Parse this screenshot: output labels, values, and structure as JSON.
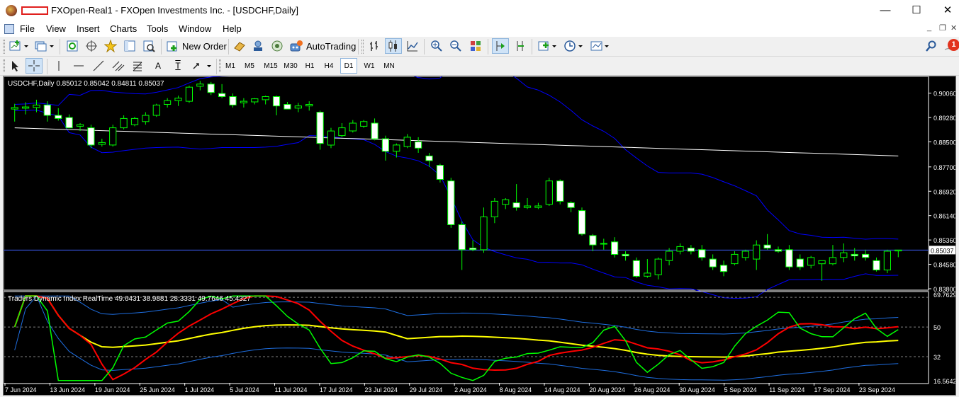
{
  "window": {
    "title": "FXOpen-Real1 - FXOpen Investments Inc. - [USDCHF,Daily]",
    "minimize_glyph": "—",
    "maximize_glyph": "☐",
    "close_glyph": "✕"
  },
  "menu": {
    "items": [
      "File",
      "View",
      "Insert",
      "Charts",
      "Tools",
      "Window",
      "Help"
    ],
    "mdi_minimize": "_",
    "mdi_restore": "❐",
    "mdi_close": "✕"
  },
  "toolbar": {
    "new_order_label": "New Order",
    "autotrading_label": "AutoTrading",
    "alert_count": "1",
    "icons": [
      "new-chart-icon",
      "profiles-icon",
      "market-watch-icon",
      "navigator-icon",
      "favorites-icon",
      "data-window-icon",
      "strategy-tester-icon",
      "new-order-icon",
      "metaeditor-icon",
      "signals-icon",
      "market-icon",
      "autotrading-icon",
      "bar-chart-icon",
      "candlestick-icon",
      "line-chart-icon",
      "zoom-in-icon",
      "zoom-out-icon",
      "tile-windows-icon",
      "chart-shift-icon",
      "autoscroll-icon",
      "indicators-icon",
      "periods-icon",
      "templates-icon",
      "search-icon",
      "alerts-icon"
    ]
  },
  "drawing_toolbar": {
    "text_tool": "A",
    "label_tool": "T"
  },
  "timeframes": {
    "items": [
      "M1",
      "M5",
      "M15",
      "M30",
      "H1",
      "H4",
      "D1",
      "W1",
      "MN"
    ],
    "selected": "D1"
  },
  "chart": {
    "header": "USDCHF,Daily  0.85012 0.85042 0.84811 0.85037",
    "current_price": "0.85037",
    "indicator_header": "Traders Dynamic Index RealTime 49.6431 38.9881 28.3331 49.7646 45.4327",
    "colors": {
      "background": "#000000",
      "bull_candle": "#00ff00",
      "bear_candle": "#ffffff",
      "bollinger": "#0000ff",
      "ma200": "#ffffff",
      "current_price_line": "#4060ff",
      "tdi_bands": "#1e6ee0",
      "tdi_price_line": "#00ff00",
      "tdi_signal_line": "#ff0000",
      "tdi_base_line": "#ffff00"
    }
  },
  "chart_data": {
    "type": "candlestick",
    "symbol": "USDCHF",
    "timeframe": "Daily",
    "ylim": [
      0.838,
      0.9055
    ],
    "price_ticks": [
      "0.90060",
      "0.89280",
      "0.88500",
      "0.87700",
      "0.86920",
      "0.86140",
      "0.85360",
      "0.84580",
      "0.83800"
    ],
    "current_price": 0.85037,
    "x_labels": [
      "7 Jun 2024",
      "13 Jun 2024",
      "19 Jun 2024",
      "25 Jun 2024",
      "1 Jul 2024",
      "5 Jul 2024",
      "11 Jul 2024",
      "17 Jul 2024",
      "23 Jul 2024",
      "29 Jul 2024",
      "2 Aug 2024",
      "8 Aug 2024",
      "14 Aug 2024",
      "20 Aug 2024",
      "26 Aug 2024",
      "30 Aug 2024",
      "5 Sep 2024",
      "11 Sep 2024",
      "17 Sep 2024",
      "23 Sep 2024"
    ],
    "candles": [
      {
        "o": 0.8955,
        "h": 0.8972,
        "l": 0.8915,
        "c": 0.896
      },
      {
        "o": 0.8958,
        "h": 0.8977,
        "l": 0.8938,
        "c": 0.8962
      },
      {
        "o": 0.896,
        "h": 0.8985,
        "l": 0.8945,
        "c": 0.8968
      },
      {
        "o": 0.8968,
        "h": 0.898,
        "l": 0.8915,
        "c": 0.8935
      },
      {
        "o": 0.8935,
        "h": 0.8958,
        "l": 0.8918,
        "c": 0.8925
      },
      {
        "o": 0.8928,
        "h": 0.8938,
        "l": 0.8905,
        "c": 0.8895
      },
      {
        "o": 0.89,
        "h": 0.891,
        "l": 0.8885,
        "c": 0.8905
      },
      {
        "o": 0.8895,
        "h": 0.8905,
        "l": 0.883,
        "c": 0.884
      },
      {
        "o": 0.8842,
        "h": 0.886,
        "l": 0.8835,
        "c": 0.8848
      },
      {
        "o": 0.884,
        "h": 0.8905,
        "l": 0.8835,
        "c": 0.8895
      },
      {
        "o": 0.8895,
        "h": 0.8935,
        "l": 0.889,
        "c": 0.8925
      },
      {
        "o": 0.8905,
        "h": 0.893,
        "l": 0.89,
        "c": 0.8925
      },
      {
        "o": 0.8915,
        "h": 0.8945,
        "l": 0.8905,
        "c": 0.8935
      },
      {
        "o": 0.8935,
        "h": 0.8972,
        "l": 0.893,
        "c": 0.8968
      },
      {
        "o": 0.897,
        "h": 0.899,
        "l": 0.896,
        "c": 0.8982
      },
      {
        "o": 0.8982,
        "h": 0.8998,
        "l": 0.8965,
        "c": 0.899
      },
      {
        "o": 0.898,
        "h": 0.903,
        "l": 0.8975,
        "c": 0.9025
      },
      {
        "o": 0.9028,
        "h": 0.9045,
        "l": 0.9015,
        "c": 0.9035
      },
      {
        "o": 0.9035,
        "h": 0.9042,
        "l": 0.9,
        "c": 0.9008
      },
      {
        "o": 0.9005,
        "h": 0.9035,
        "l": 0.899,
        "c": 0.8995
      },
      {
        "o": 0.8995,
        "h": 0.9005,
        "l": 0.896,
        "c": 0.8968
      },
      {
        "o": 0.8975,
        "h": 0.899,
        "l": 0.896,
        "c": 0.898
      },
      {
        "o": 0.8978,
        "h": 0.899,
        "l": 0.897,
        "c": 0.8988
      },
      {
        "o": 0.8985,
        "h": 0.8998,
        "l": 0.897,
        "c": 0.8995
      },
      {
        "o": 0.8995,
        "h": 0.8998,
        "l": 0.8935,
        "c": 0.8965
      },
      {
        "o": 0.897,
        "h": 0.8978,
        "l": 0.8955,
        "c": 0.8955
      },
      {
        "o": 0.8958,
        "h": 0.8975,
        "l": 0.8945,
        "c": 0.8965
      },
      {
        "o": 0.8965,
        "h": 0.898,
        "l": 0.895,
        "c": 0.897
      },
      {
        "o": 0.8945,
        "h": 0.895,
        "l": 0.8825,
        "c": 0.8845
      },
      {
        "o": 0.884,
        "h": 0.8895,
        "l": 0.883,
        "c": 0.8885
      },
      {
        "o": 0.887,
        "h": 0.891,
        "l": 0.8865,
        "c": 0.8895
      },
      {
        "o": 0.8885,
        "h": 0.892,
        "l": 0.888,
        "c": 0.891
      },
      {
        "o": 0.89,
        "h": 0.892,
        "l": 0.8895,
        "c": 0.8915
      },
      {
        "o": 0.891,
        "h": 0.8925,
        "l": 0.8855,
        "c": 0.886
      },
      {
        "o": 0.886,
        "h": 0.887,
        "l": 0.879,
        "c": 0.882
      },
      {
        "o": 0.882,
        "h": 0.8845,
        "l": 0.88,
        "c": 0.884
      },
      {
        "o": 0.8835,
        "h": 0.8875,
        "l": 0.883,
        "c": 0.8865
      },
      {
        "o": 0.885,
        "h": 0.8865,
        "l": 0.8815,
        "c": 0.883
      },
      {
        "o": 0.8805,
        "h": 0.8815,
        "l": 0.877,
        "c": 0.879
      },
      {
        "o": 0.8775,
        "h": 0.878,
        "l": 0.872,
        "c": 0.873
      },
      {
        "o": 0.8725,
        "h": 0.8735,
        "l": 0.8575,
        "c": 0.8585
      },
      {
        "o": 0.8585,
        "h": 0.8595,
        "l": 0.844,
        "c": 0.8505
      },
      {
        "o": 0.851,
        "h": 0.8535,
        "l": 0.85,
        "c": 0.8505
      },
      {
        "o": 0.8505,
        "h": 0.864,
        "l": 0.8495,
        "c": 0.861
      },
      {
        "o": 0.861,
        "h": 0.867,
        "l": 0.859,
        "c": 0.866
      },
      {
        "o": 0.865,
        "h": 0.867,
        "l": 0.8635,
        "c": 0.8665
      },
      {
        "o": 0.8655,
        "h": 0.8715,
        "l": 0.863,
        "c": 0.864
      },
      {
        "o": 0.864,
        "h": 0.867,
        "l": 0.8635,
        "c": 0.8645
      },
      {
        "o": 0.864,
        "h": 0.8655,
        "l": 0.8635,
        "c": 0.8645
      },
      {
        "o": 0.865,
        "h": 0.8735,
        "l": 0.8645,
        "c": 0.8725
      },
      {
        "o": 0.8725,
        "h": 0.873,
        "l": 0.865,
        "c": 0.866
      },
      {
        "o": 0.8655,
        "h": 0.866,
        "l": 0.8625,
        "c": 0.864
      },
      {
        "o": 0.863,
        "h": 0.864,
        "l": 0.855,
        "c": 0.8555
      },
      {
        "o": 0.855,
        "h": 0.8555,
        "l": 0.85,
        "c": 0.852
      },
      {
        "o": 0.8525,
        "h": 0.854,
        "l": 0.8505,
        "c": 0.8525
      },
      {
        "o": 0.853,
        "h": 0.8545,
        "l": 0.848,
        "c": 0.849
      },
      {
        "o": 0.849,
        "h": 0.85,
        "l": 0.847,
        "c": 0.8485
      },
      {
        "o": 0.847,
        "h": 0.848,
        "l": 0.8415,
        "c": 0.842
      },
      {
        "o": 0.842,
        "h": 0.8475,
        "l": 0.8415,
        "c": 0.843
      },
      {
        "o": 0.8425,
        "h": 0.848,
        "l": 0.841,
        "c": 0.8475
      },
      {
        "o": 0.847,
        "h": 0.851,
        "l": 0.8455,
        "c": 0.85
      },
      {
        "o": 0.85,
        "h": 0.8525,
        "l": 0.849,
        "c": 0.8515
      },
      {
        "o": 0.851,
        "h": 0.852,
        "l": 0.849,
        "c": 0.85
      },
      {
        "o": 0.8505,
        "h": 0.852,
        "l": 0.847,
        "c": 0.848
      },
      {
        "o": 0.8475,
        "h": 0.849,
        "l": 0.844,
        "c": 0.845
      },
      {
        "o": 0.8455,
        "h": 0.847,
        "l": 0.842,
        "c": 0.8435
      },
      {
        "o": 0.846,
        "h": 0.85,
        "l": 0.8455,
        "c": 0.849
      },
      {
        "o": 0.848,
        "h": 0.8505,
        "l": 0.847,
        "c": 0.85
      },
      {
        "o": 0.8475,
        "h": 0.8535,
        "l": 0.844,
        "c": 0.852
      },
      {
        "o": 0.852,
        "h": 0.8555,
        "l": 0.8505,
        "c": 0.851
      },
      {
        "o": 0.8505,
        "h": 0.8515,
        "l": 0.8495,
        "c": 0.85
      },
      {
        "o": 0.8505,
        "h": 0.852,
        "l": 0.844,
        "c": 0.845
      },
      {
        "o": 0.8475,
        "h": 0.849,
        "l": 0.844,
        "c": 0.845
      },
      {
        "o": 0.8455,
        "h": 0.8485,
        "l": 0.8445,
        "c": 0.848
      },
      {
        "o": 0.846,
        "h": 0.847,
        "l": 0.8405,
        "c": 0.847
      },
      {
        "o": 0.846,
        "h": 0.852,
        "l": 0.8455,
        "c": 0.848
      },
      {
        "o": 0.848,
        "h": 0.8525,
        "l": 0.8465,
        "c": 0.8495
      },
      {
        "o": 0.849,
        "h": 0.851,
        "l": 0.847,
        "c": 0.8485
      },
      {
        "o": 0.849,
        "h": 0.8505,
        "l": 0.847,
        "c": 0.848
      },
      {
        "o": 0.847,
        "h": 0.848,
        "l": 0.8435,
        "c": 0.844
      },
      {
        "o": 0.844,
        "h": 0.8505,
        "l": 0.843,
        "c": 0.85
      },
      {
        "o": 0.8501,
        "h": 0.8504,
        "l": 0.8481,
        "c": 0.8504
      }
    ],
    "indicator": {
      "name": "Traders Dynamic Index RealTime",
      "values": [
        49.6431,
        38.9881,
        28.3331,
        49.7646,
        45.4327
      ],
      "ylim": [
        16.5642,
        69.7629
      ],
      "ticks": [
        "69.7629",
        "50",
        "32",
        "16.5642"
      ]
    }
  }
}
